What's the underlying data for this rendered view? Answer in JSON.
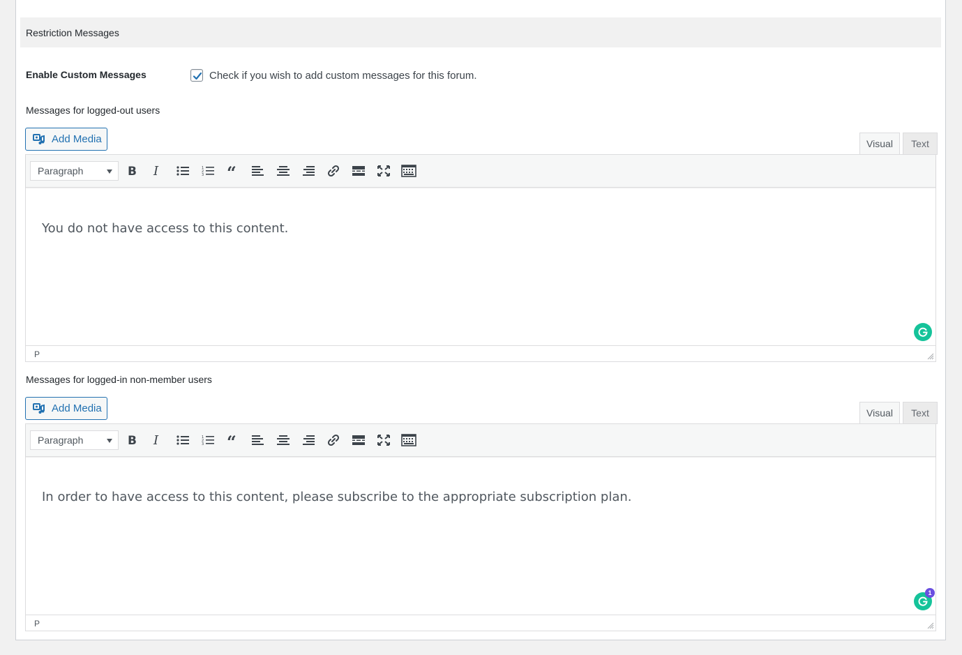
{
  "section": {
    "title": "Restriction Messages"
  },
  "enable": {
    "label": "Enable Custom Messages",
    "checked": true,
    "description": "Check if you wish to add custom messages for this forum."
  },
  "editors": [
    {
      "label": "Messages for logged-out users",
      "add_media": "Add Media",
      "tab_visual": "Visual",
      "tab_text": "Text",
      "format": "Paragraph",
      "content": "You do not have access to this content.",
      "path": "P",
      "grammarly_badge": ""
    },
    {
      "label": "Messages for logged-in non-member users",
      "add_media": "Add Media",
      "tab_visual": "Visual",
      "tab_text": "Text",
      "format": "Paragraph",
      "content": "In order to have access to this content, please subscribe to the appropriate subscription plan.",
      "path": "P",
      "grammarly_badge": "1"
    }
  ],
  "toolbar_icons": [
    "bold-icon",
    "italic-icon",
    "bullet-list-icon",
    "numbered-list-icon",
    "blockquote-icon",
    "align-left-icon",
    "align-center-icon",
    "align-right-icon",
    "link-icon",
    "read-more-icon",
    "fullscreen-icon",
    "toolbar-toggle-icon"
  ],
  "colors": {
    "accent": "#2271b1",
    "grammarly": "#15c39a",
    "checkmark": "#2271b1"
  }
}
